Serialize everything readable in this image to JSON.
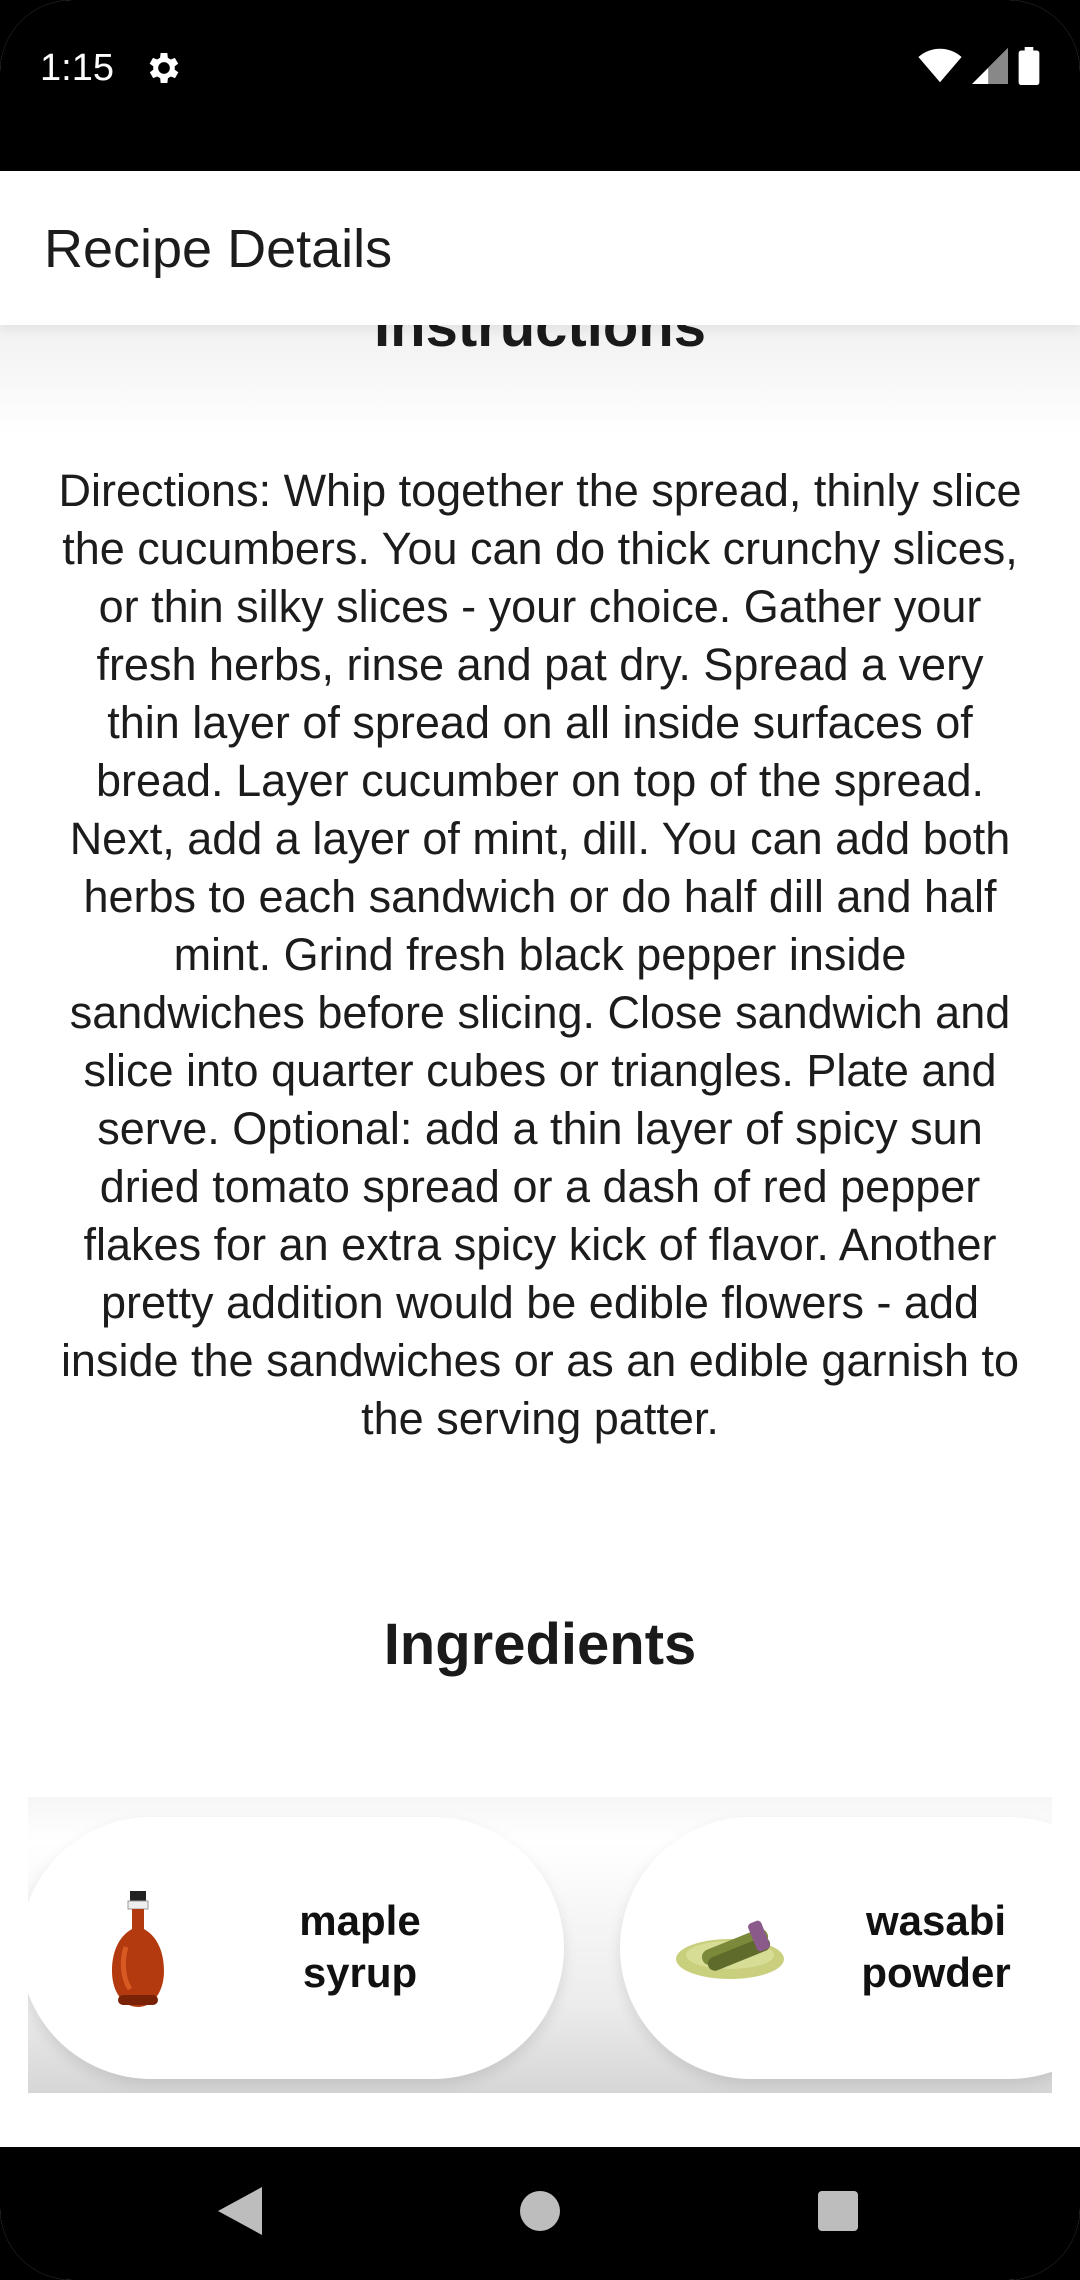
{
  "status_bar": {
    "time": "1:15",
    "icons": [
      "settings-gear-icon",
      "wifi-icon",
      "cellular-signal-icon",
      "battery-icon"
    ]
  },
  "app_bar": {
    "title": "Recipe Details"
  },
  "instructions": {
    "heading": "Instructions",
    "text": "Directions: Whip together the spread, thinly slice the cucumbers. You can do thick crunchy slices, or thin silky slices - your choice. Gather your fresh herbs, rinse and pat dry. Spread a very thin layer of spread on all inside surfaces of bread. Layer cucumber on top of the spread. Next, add a layer of mint, dill. You can add both herbs to each sandwich or do half dill and half mint. Grind fresh black pepper inside sandwiches before slicing. Close sandwich and slice into quarter cubes or triangles. Plate and serve. Optional: add a thin layer of spicy sun dried tomato spread or a dash of red pepper flakes for an extra spicy kick of flavor. Another pretty addition would be edible flowers - add inside the sandwiches or as an edible garnish to the serving patter."
  },
  "ingredients": {
    "heading": "Ingredients",
    "items": [
      {
        "name": "maple syrup",
        "image": "maple-syrup-bottle-icon"
      },
      {
        "name": "wasabi powder",
        "image": "wasabi-powder-icon"
      }
    ]
  },
  "nav_bar": {
    "buttons": [
      "back-icon",
      "home-icon",
      "recents-icon"
    ]
  },
  "colors": {
    "status_bar_bg": "#000000",
    "app_bar_bg": "#ffffff",
    "text": "#1c1c1c"
  }
}
